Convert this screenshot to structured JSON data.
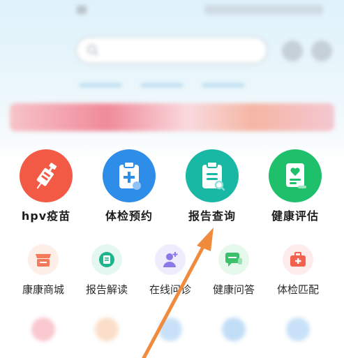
{
  "main_services": [
    {
      "label": "hpv疫苗",
      "icon": "syringe-icon",
      "color": "#f25a46"
    },
    {
      "label": "体检预约",
      "icon": "clipboard-plus-icon",
      "color": "#2e8de8"
    },
    {
      "label": "报告查询",
      "icon": "report-search-icon",
      "color": "#18b8a5"
    },
    {
      "label": "健康评估",
      "icon": "heart-document-icon",
      "color": "#1fc06c"
    }
  ],
  "sub_services": [
    {
      "label": "康康商城",
      "icon": "store-icon",
      "color": "#f47a5a",
      "bg": "#fdeee8"
    },
    {
      "label": "报告解读",
      "icon": "report-chat-icon",
      "color": "#1fb58c",
      "bg": "#e5f7f1"
    },
    {
      "label": "在线问诊",
      "icon": "doctor-icon",
      "color": "#8a7ae8",
      "bg": "#efecfd"
    },
    {
      "label": "健康问答",
      "icon": "qa-chat-icon",
      "color": "#3cc06b",
      "bg": "#e7f8ed"
    },
    {
      "label": "体检匹配",
      "icon": "medical-kit-icon",
      "color": "#f4604e",
      "bg": "#fdeceb"
    }
  ],
  "annotation_arrow_color": "#f08a3c"
}
